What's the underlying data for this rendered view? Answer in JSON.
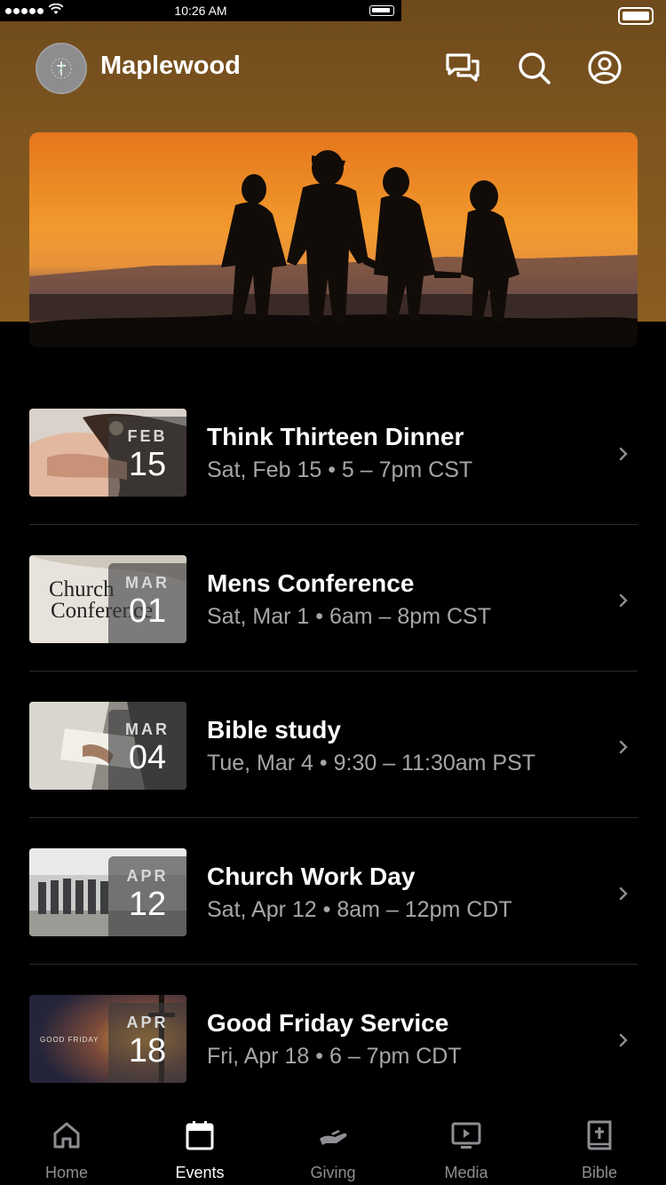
{
  "status_bar": {
    "time": "10:26 AM"
  },
  "header": {
    "app_name": "Maplewood",
    "icons": [
      "chat-icon",
      "search-icon",
      "profile-icon"
    ]
  },
  "events": [
    {
      "title": "Think Thirteen Dinner",
      "month": "FEB",
      "day": "15",
      "meta": "Sat, Feb 15 • 5 – 7pm CST"
    },
    {
      "title": "Mens Conference",
      "month": "MAR",
      "day": "01",
      "meta": "Sat, Mar 1 • 6am – 8pm CST",
      "thumb_text": [
        "Church",
        "Conference"
      ]
    },
    {
      "title": "Bible study",
      "month": "MAR",
      "day": "04",
      "meta": "Tue, Mar 4 • 9:30 – 11:30am PST"
    },
    {
      "title": "Church Work Day",
      "month": "APR",
      "day": "12",
      "meta": "Sat, Apr 12 • 8am – 12pm CDT"
    },
    {
      "title": "Good Friday Service",
      "month": "APR",
      "day": "18",
      "meta": "Fri, Apr 18 • 6 – 7pm CDT",
      "thumb_text": [
        "GOOD FRIDAY"
      ]
    }
  ],
  "tabs": [
    {
      "label": "Home",
      "icon": "home-icon",
      "active": false
    },
    {
      "label": "Events",
      "icon": "calendar-icon",
      "active": true
    },
    {
      "label": "Giving",
      "icon": "giving-icon",
      "active": false
    },
    {
      "label": "Media",
      "icon": "media-icon",
      "active": false
    },
    {
      "label": "Bible",
      "icon": "bible-icon",
      "active": false
    }
  ],
  "colors": {
    "header_background": "#7f561f",
    "page_background": "#000000",
    "secondary_text": "#a6a6aa",
    "inactive_tab": "#8e8e93"
  }
}
